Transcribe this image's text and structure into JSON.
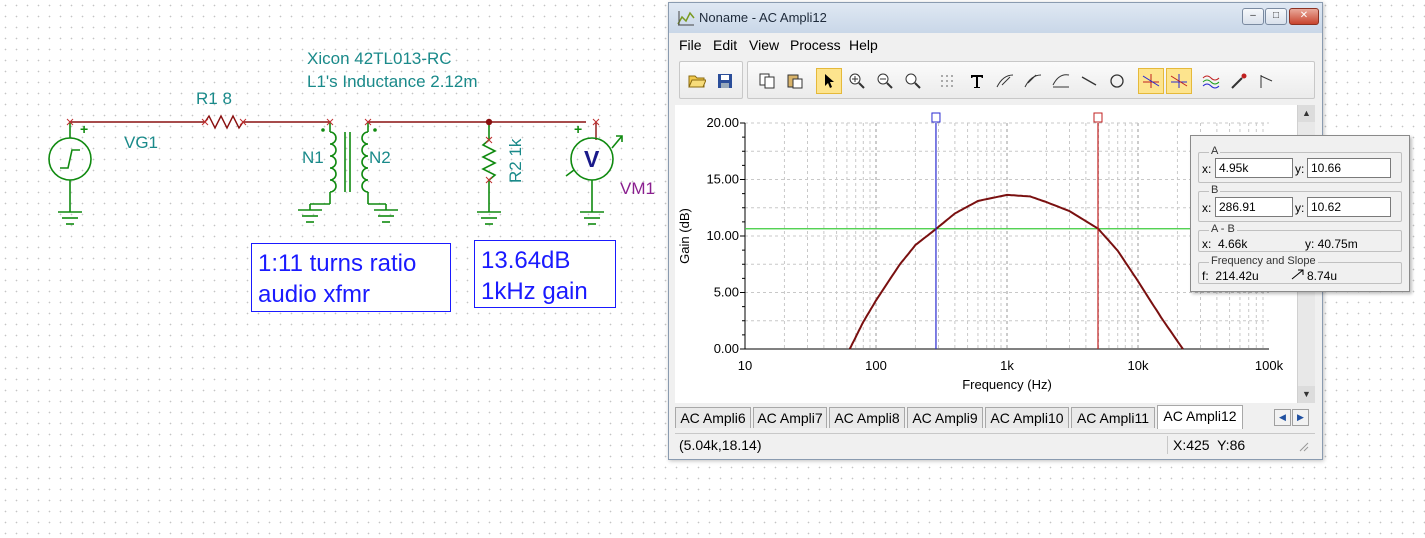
{
  "schematic": {
    "vg1_label": "VG1",
    "r1_label": "R1 8",
    "xfmr_title": "Xicon 42TL013-RC",
    "xfmr_inductance": "L1's Inductance 2.12m",
    "n1_label": "N1",
    "n2_label": "N2",
    "r2_label": "R2 1k",
    "vm1_label": "VM1",
    "meter_symbol": "V",
    "plus_sign": "+",
    "note1": "1:11 turns ratio\naudio xfmr",
    "note2": "13.64dB\n1kHz gain"
  },
  "window": {
    "title": "Noname - AC Ampli12",
    "controls": {
      "minimize": "–",
      "maximize": "□",
      "close": "✕"
    },
    "menu": [
      "File",
      "Edit",
      "View",
      "Process",
      "Help"
    ],
    "toolbar_icons": [
      "open-icon",
      "save-icon",
      "copy-icon",
      "paste-icon",
      "pointer-icon",
      "zoom-in-icon",
      "zoom-out-icon",
      "zoom-100-icon",
      "grid-icon",
      "text-icon",
      "cursor-probe-icon",
      "cursor-probe-2-icon",
      "cursor-fx-icon",
      "line-icon",
      "circle-icon",
      "cursor-a-icon",
      "cursor-b-icon",
      "curves-icon",
      "marker-icon",
      "flag-icon"
    ],
    "tabs": [
      "AC Ampli6",
      "AC Ampli7",
      "AC Ampli8",
      "AC Ampli9",
      "AC Ampli10",
      "AC Ampli11",
      "AC Ampli12"
    ],
    "active_tab": "AC Ampli12",
    "status_left": "(5.04k,18.14)",
    "status_right": "X:425  Y:86"
  },
  "cursor_panel": {
    "a_title": "A",
    "a_x_label": "x:",
    "a_x": "4.95k",
    "a_y_label": "y:",
    "a_y": "10.66",
    "b_title": "B",
    "b_x_label": "x:",
    "b_x": "286.91",
    "b_y_label": "y:",
    "b_y": "10.62",
    "ab_title": "A - B",
    "ab_x": "x:  4.66k",
    "ab_y": "y: 40.75m",
    "fs_title": "Frequency and Slope",
    "f_value": "f:  214.42u",
    "slope_value": "8.74u"
  },
  "chart_data": {
    "type": "line",
    "xscale": "log",
    "xlim": [
      10,
      100000
    ],
    "ylim": [
      0,
      20
    ],
    "xlabel": "Frequency (Hz)",
    "ylabel": "Gain (dB)",
    "xticks": [
      10,
      100,
      1000,
      10000,
      100000
    ],
    "xtick_labels": [
      "10",
      "100",
      "1k",
      "10k",
      "100k"
    ],
    "yticks": [
      0,
      5,
      10,
      15,
      20
    ],
    "ytick_labels": [
      "0.00",
      "5.00",
      "10.00",
      "15.00",
      "20.00"
    ],
    "grid": true,
    "series": [
      {
        "color": "#7a1010",
        "x": [
          63,
          80,
          100,
          150,
          200,
          286.91,
          400,
          600,
          1000,
          1500,
          2000,
          3000,
          4950,
          7000,
          10000,
          15000,
          22000
        ],
        "y": [
          0,
          2.4,
          4.3,
          7.4,
          9.2,
          10.62,
          12.0,
          13.1,
          13.64,
          13.5,
          13.0,
          12.2,
          10.66,
          8.7,
          6.0,
          2.8,
          0
        ]
      }
    ],
    "cursors": [
      {
        "name": "a",
        "x": 286.91,
        "color": "#2a2ad0"
      },
      {
        "name": "b",
        "x": 4950,
        "color": "#c02020"
      }
    ],
    "hline": {
      "y": 10.64,
      "color": "#3ccc3c"
    }
  }
}
